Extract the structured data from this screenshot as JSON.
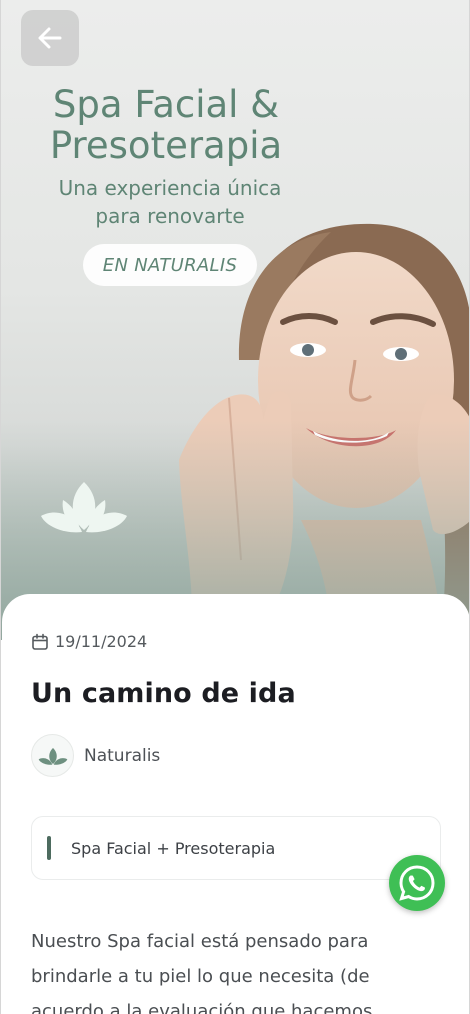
{
  "hero": {
    "title_line1": "Spa Facial &",
    "title_line2": "Presoterapia",
    "subtitle_line1": "Una experiencia única",
    "subtitle_line2": "para renovarte",
    "badge": "EN NATURALIS",
    "back_icon": "arrow-left-icon",
    "logo_icon": "leaf-logo-icon"
  },
  "post": {
    "date_icon": "calendar-icon",
    "date": "19/11/2024",
    "title": "Un camino de ida",
    "author": "Naturalis",
    "tag": "Spa Facial + Presoterapia",
    "body": "Nuestro Spa facial está pensado para brindarle a tu piel lo que necesita (de acuerdo a la evaluación que hacemos"
  },
  "whatsapp": {
    "icon": "whatsapp-icon"
  },
  "colors": {
    "brand_green": "#5f8575",
    "tag_bar": "#4d6b5f",
    "whatsapp_green": "#3fbf55"
  }
}
